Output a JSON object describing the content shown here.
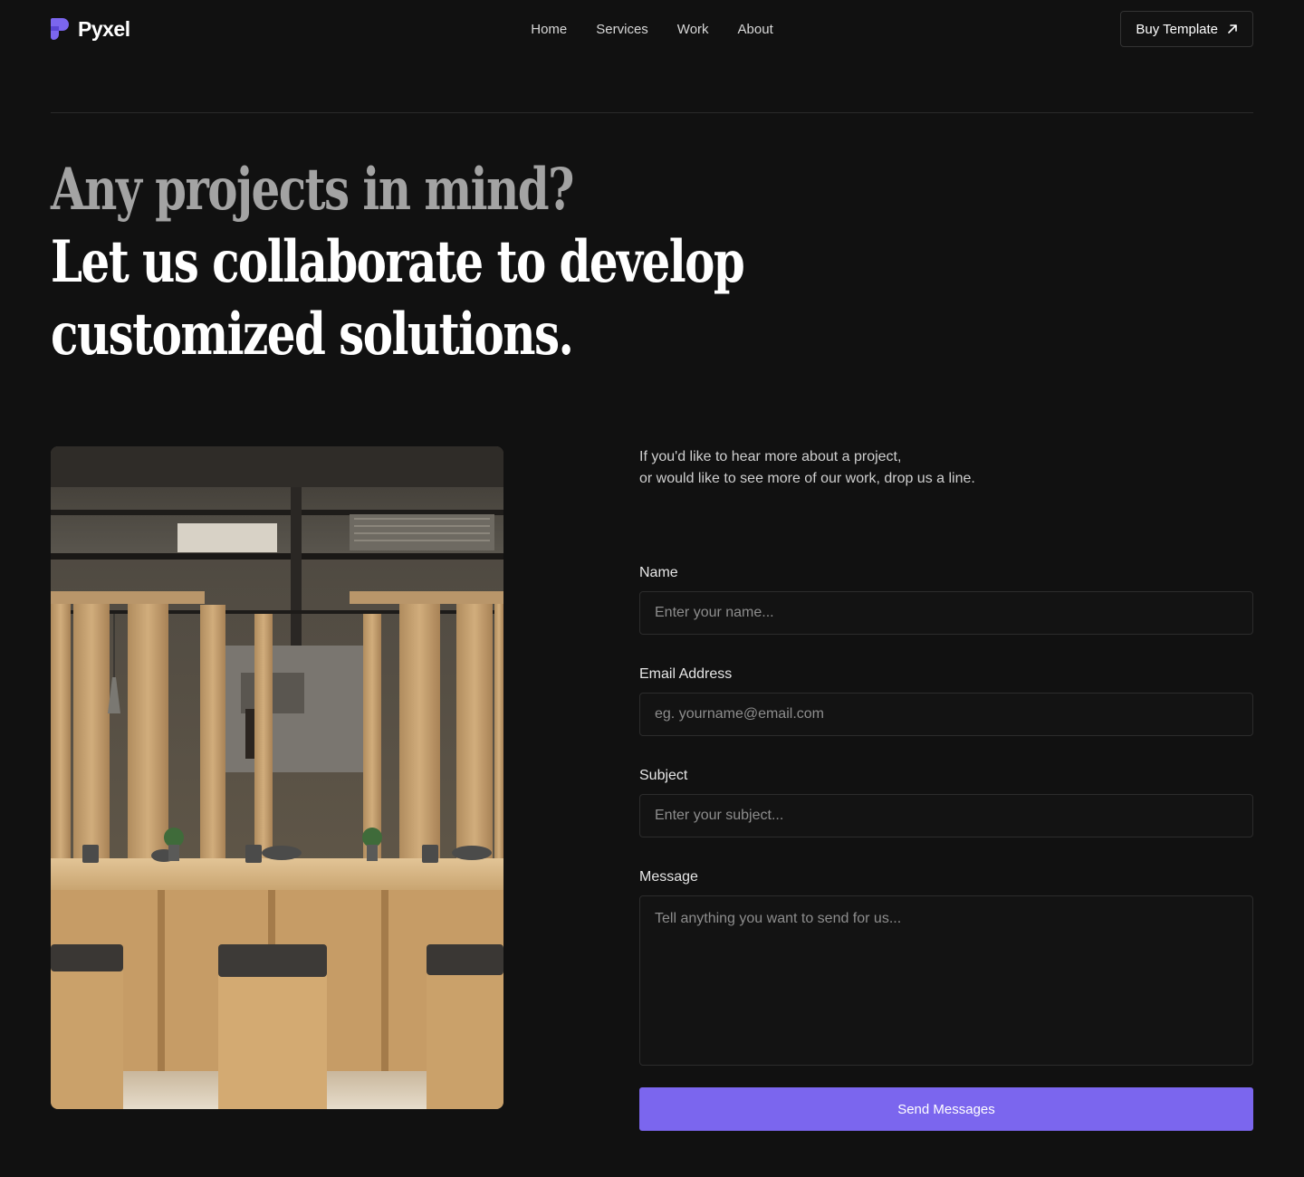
{
  "brand": {
    "name": "Pyxel",
    "accent_color": "#7b66ee"
  },
  "nav": {
    "items": [
      {
        "label": "Home"
      },
      {
        "label": "Services"
      },
      {
        "label": "Work"
      },
      {
        "label": "About"
      }
    ],
    "cta_label": "Buy Template",
    "cta_icon": "arrow-up-right-icon"
  },
  "hero": {
    "line1": "Any projects in mind?",
    "line2": "Let us collaborate to develop",
    "line3": "customized solutions."
  },
  "contact": {
    "intro_line1": "If you'd like to hear more about a project,",
    "intro_line2": "or would like to see more of our work, drop us a line.",
    "fields": {
      "name": {
        "label": "Name",
        "placeholder": "Enter your name...",
        "value": ""
      },
      "email": {
        "label": "Email Address",
        "placeholder": "eg. yourname@email.com",
        "value": ""
      },
      "subject": {
        "label": "Subject",
        "placeholder": "Enter your subject...",
        "value": ""
      },
      "message": {
        "label": "Message",
        "placeholder": "Tell anything you want to send for us...",
        "value": ""
      }
    },
    "submit_label": "Send Messages"
  }
}
